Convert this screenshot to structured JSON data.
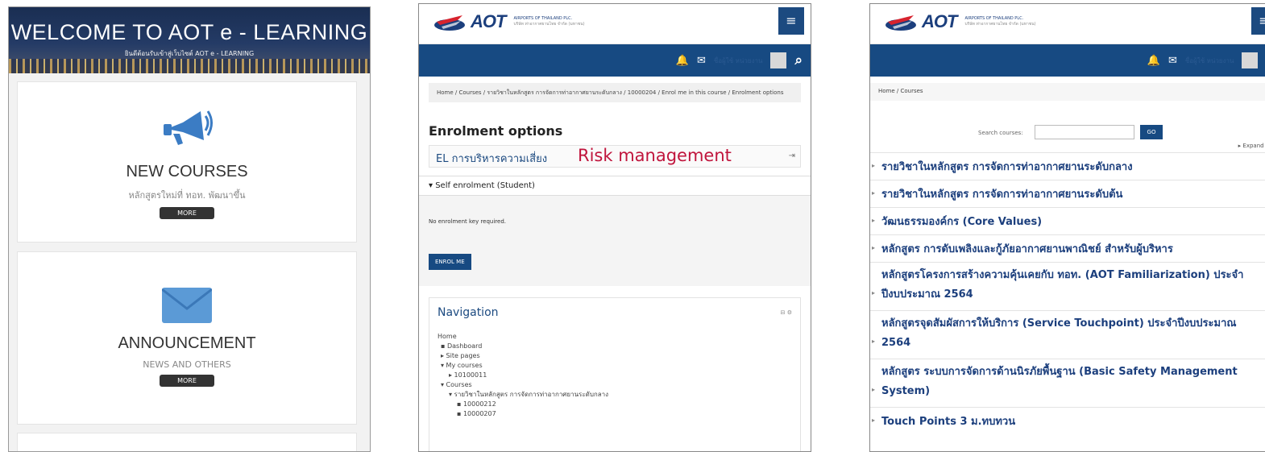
{
  "panel1": {
    "banner": {
      "title": "WELCOME TO AOT e - LEARNING",
      "subtitle": "ยินดีต้อนรับเข้าสู่เว็บไซต์ AOT e - LEARNING"
    },
    "cards": [
      {
        "icon": "megaphone-icon",
        "title": "NEW COURSES",
        "subtitle": "หลักสูตรใหม่ที่ ทอท. พัฒนาขึ้น",
        "button": "MORE"
      },
      {
        "icon": "envelope-icon",
        "title": "ANNOUNCEMENT",
        "subtitle": "NEWS AND OTHERS",
        "button": "MORE"
      }
    ]
  },
  "brand": {
    "logo_text": "AOT",
    "company_en": "AIRPORTS OF THAILAND PLC.",
    "company_th": "บริษัท ท่าอากาศยานไทย จำกัด (มหาชน)",
    "accent": "#174a82",
    "logo_red": "#d7232e"
  },
  "navbar": {
    "hamburger": "≡",
    "bell": "🔔",
    "mail": "✉",
    "user_name": "ชื่อผู้ใช้ หน่วยงาน",
    "search": "🔍"
  },
  "panel2": {
    "breadcrumb": "Home / Courses / รายวิชาในหลักสูตร การจัดการท่าอากาศยานระดับกลาง / 10000204 / Enrol me in this course / Enrolment options",
    "heading": "Enrolment options",
    "course_name": "EL การบริหารความเสี่ยง",
    "annotation": "Risk management",
    "enter_icon": "⇥",
    "self_enrol": "Self enrolment (Student)",
    "no_key": "No enrolment key required.",
    "enrol_button": "ENROL ME",
    "navigation": {
      "title": "Navigation",
      "tools": "⊟ ⚙",
      "items": [
        {
          "label": "Home",
          "level": 0
        },
        {
          "label": "▪ Dashboard",
          "level": 1
        },
        {
          "label": "▸ Site pages",
          "level": 1
        },
        {
          "label": "▾ My courses",
          "level": 1
        },
        {
          "label": "▸ 10100011",
          "level": 2
        },
        {
          "label": "▾ Courses",
          "level": 1
        },
        {
          "label": "▾ รายวิชาในหลักสูตร การจัดการท่าอากาศยานระดับกลาง",
          "level": 2
        },
        {
          "label": "▪ 10000212",
          "level": 3
        },
        {
          "label": "▪ 10000207",
          "level": 3
        }
      ]
    }
  },
  "panel3": {
    "breadcrumb": "Home / Courses",
    "search_label": "Search courses:",
    "go": "GO",
    "expand": "▸ Expand all",
    "categories": [
      "รายวิชาในหลักสูตร การจัดการท่าอากาศยานระดับกลาง",
      "รายวิชาในหลักสูตร การจัดการท่าอากาศยานระดับต้น",
      "วัฒนธรรมองค์กร (Core Values)",
      "หลักสูตร การดับเพลิงและกู้ภัยอากาศยานพาณิชย์ สำหรับผู้บริหาร",
      "หลักสูตรโครงการสร้างความคุ้นเคยกับ ทอท. (AOT Familiarization) ประจำปีงบประมาณ 2564",
      "หลักสูตรจุดสัมผัสการให้บริการ (Service Touchpoint) ประจำปีงบประมาณ 2564",
      "หลักสูตร ระบบการจัดการด้านนิรภัยพื้นฐาน (Basic Safety Management System)",
      "Touch Points 3 ม.ทบทวน"
    ]
  }
}
